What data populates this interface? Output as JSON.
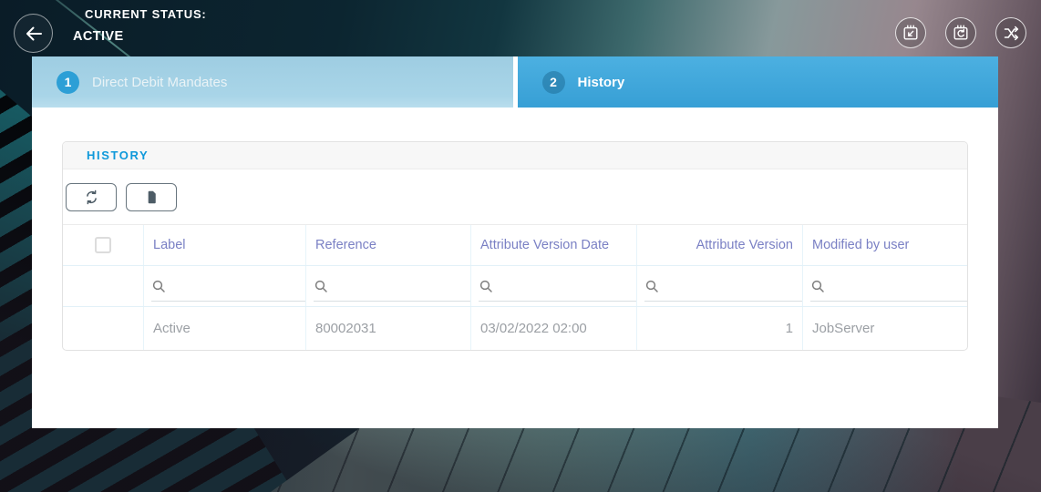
{
  "header": {
    "status_label": "CURRENT STATUS:",
    "status_value": "ACTIVE",
    "actions": [
      {
        "icon": "export-card-icon"
      },
      {
        "icon": "card-refresh-icon"
      },
      {
        "icon": "shuffle-icon"
      }
    ]
  },
  "tabs": [
    {
      "number": "1",
      "label": "Direct Debit Mandates",
      "active": false
    },
    {
      "number": "2",
      "label": "History",
      "active": true
    }
  ],
  "panel": {
    "title": "HISTORY",
    "toolbar": [
      {
        "icon": "refresh-icon"
      },
      {
        "icon": "document-icon"
      }
    ],
    "table": {
      "columns": [
        "Label",
        "Reference",
        "Attribute Version Date",
        "Attribute Version",
        "Modified by user"
      ],
      "rows": [
        [
          "Active",
          "80002031",
          "03/02/2022 02:00",
          "1",
          "JobServer"
        ]
      ]
    }
  },
  "colors": {
    "active_tab_blue": "#3aa7dd",
    "inactive_tab_blue": "#a7d4e7",
    "panel_title_blue": "#0f99da",
    "column_header_purple": "#7a80c4",
    "calendar_pink": "#c353c9",
    "data_text_gray": "#9b9fa4"
  }
}
